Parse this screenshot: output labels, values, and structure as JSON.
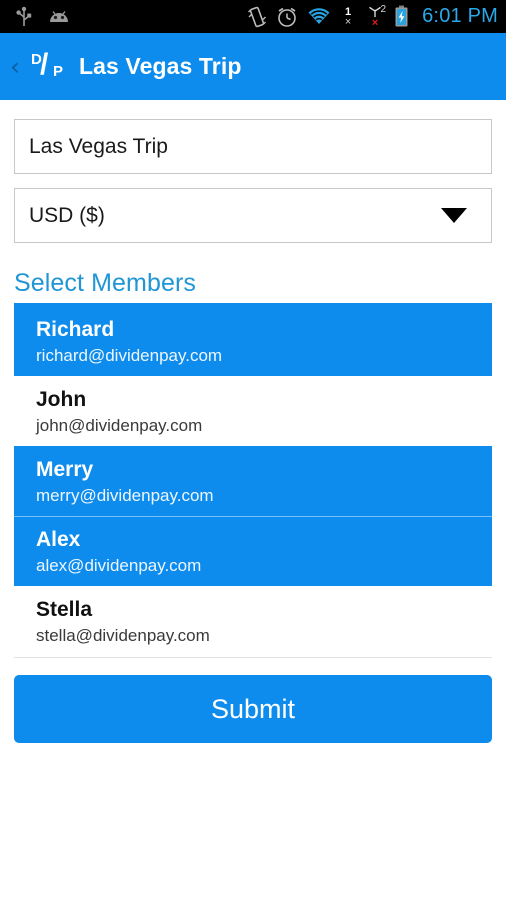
{
  "status_bar": {
    "icons_left": [
      "usb-icon",
      "android-debug-icon"
    ],
    "icons_right": [
      "vibrate-icon",
      "alarm-icon",
      "wifi-icon",
      "sim1-no-service-icon",
      "sim2-no-service-icon",
      "battery-charging-icon"
    ],
    "sim1_label": "1",
    "sim1_state": "×",
    "sim2_label": "2",
    "sim2_state": "×",
    "clock": "6:01 PM"
  },
  "action_bar": {
    "back_label": "‹",
    "logo_d": "D",
    "logo_slash": "/",
    "logo_p": "P",
    "title": "Las Vegas Trip"
  },
  "form": {
    "trip_name": {
      "value": "Las Vegas Trip",
      "placeholder": "Trip name"
    },
    "currency": {
      "selected": "USD ($)",
      "options": [
        "USD ($)"
      ]
    }
  },
  "members_section": {
    "header": "Select Members",
    "items": [
      {
        "name": "Richard",
        "email": "richard@dividenpay.com",
        "selected": true
      },
      {
        "name": "John",
        "email": "john@dividenpay.com",
        "selected": false
      },
      {
        "name": "Merry",
        "email": "merry@dividenpay.com",
        "selected": true
      },
      {
        "name": "Alex",
        "email": "alex@dividenpay.com",
        "selected": true
      },
      {
        "name": "Stella",
        "email": "stella@dividenpay.com",
        "selected": false
      }
    ]
  },
  "submit": {
    "label": "Submit"
  },
  "colors": {
    "accent_blue": "#0d8cee",
    "header_text_blue": "#2096d6",
    "status_clock_blue": "#2aa8e8",
    "status_bg": "#000000",
    "page_bg": "#ffffff"
  }
}
